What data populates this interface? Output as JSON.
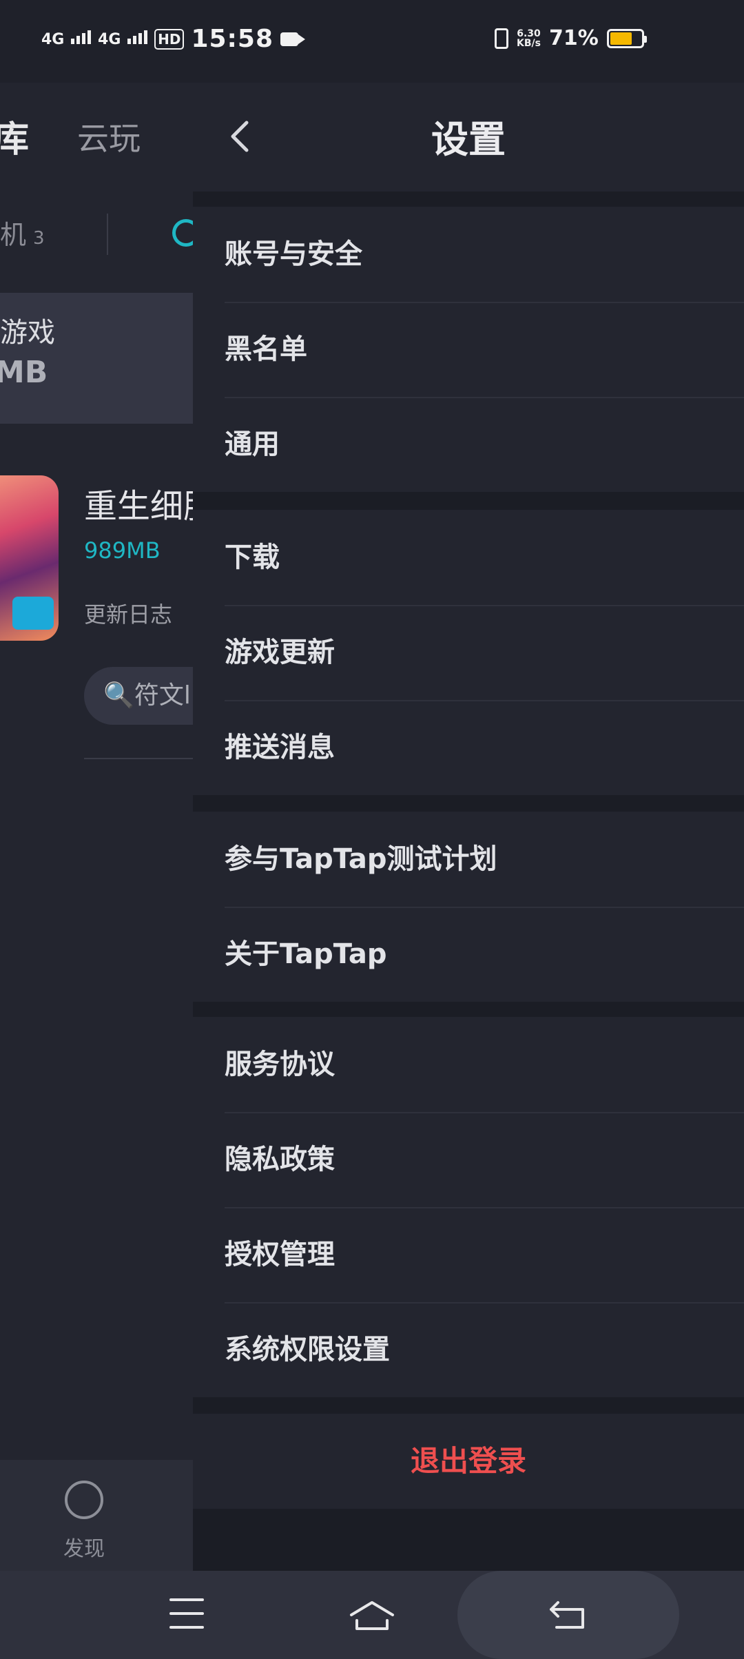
{
  "status_bar": {
    "network1": "4G",
    "network2": "4G",
    "hd": "HD",
    "time": "15:58",
    "speed_value": "6.30",
    "speed_unit": "KB/s",
    "battery": "71%",
    "battery_level": 0.71,
    "battery_color": "#f5b800"
  },
  "background_page": {
    "tab_library": "库",
    "tab_cloud": "云玩",
    "sub_tab": "机",
    "sub_tab_count": "3",
    "card_title": "游戏",
    "card_size": "MB",
    "game_name": "重生细胞",
    "game_size": "989MB",
    "changelog": "更新日志",
    "search_chip": "🔍符文l",
    "bottom_nav_discover": "发现",
    "accent_color": "#1fb7c4"
  },
  "settings": {
    "title": "设置",
    "groups": [
      {
        "items": [
          "账号与安全",
          "黑名单",
          "通用"
        ]
      },
      {
        "items": [
          "下载",
          "游戏更新",
          "推送消息"
        ]
      },
      {
        "items": [
          "参与TapTap测试计划",
          "关于TapTap"
        ]
      },
      {
        "items": [
          "服务协议",
          "隐私政策",
          "授权管理",
          "系统权限设置"
        ]
      }
    ],
    "logout": "退出登录",
    "logout_color": "#ef4f4f"
  }
}
